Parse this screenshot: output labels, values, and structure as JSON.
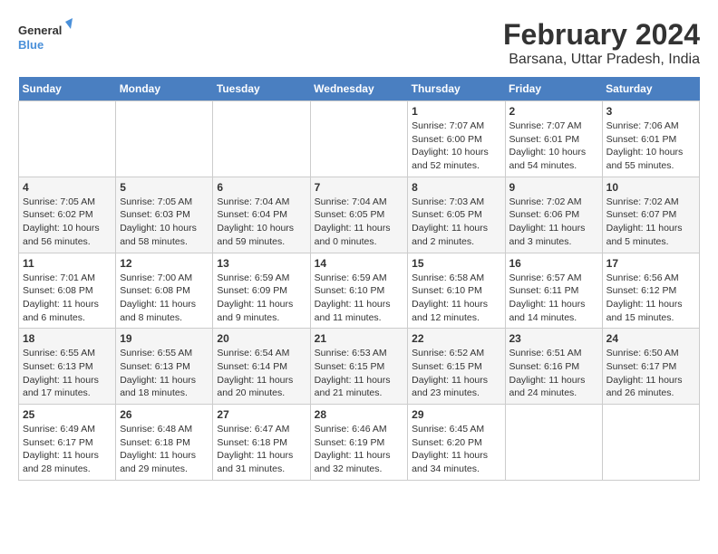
{
  "logo": {
    "line1": "General",
    "line2": "Blue"
  },
  "title": "February 2024",
  "subtitle": "Barsana, Uttar Pradesh, India",
  "days_header": [
    "Sunday",
    "Monday",
    "Tuesday",
    "Wednesday",
    "Thursday",
    "Friday",
    "Saturday"
  ],
  "weeks": [
    [
      {
        "num": "",
        "info": ""
      },
      {
        "num": "",
        "info": ""
      },
      {
        "num": "",
        "info": ""
      },
      {
        "num": "",
        "info": ""
      },
      {
        "num": "1",
        "info": "Sunrise: 7:07 AM\nSunset: 6:00 PM\nDaylight: 10 hours\nand 52 minutes."
      },
      {
        "num": "2",
        "info": "Sunrise: 7:07 AM\nSunset: 6:01 PM\nDaylight: 10 hours\nand 54 minutes."
      },
      {
        "num": "3",
        "info": "Sunrise: 7:06 AM\nSunset: 6:01 PM\nDaylight: 10 hours\nand 55 minutes."
      }
    ],
    [
      {
        "num": "4",
        "info": "Sunrise: 7:05 AM\nSunset: 6:02 PM\nDaylight: 10 hours\nand 56 minutes."
      },
      {
        "num": "5",
        "info": "Sunrise: 7:05 AM\nSunset: 6:03 PM\nDaylight: 10 hours\nand 58 minutes."
      },
      {
        "num": "6",
        "info": "Sunrise: 7:04 AM\nSunset: 6:04 PM\nDaylight: 10 hours\nand 59 minutes."
      },
      {
        "num": "7",
        "info": "Sunrise: 7:04 AM\nSunset: 6:05 PM\nDaylight: 11 hours\nand 0 minutes."
      },
      {
        "num": "8",
        "info": "Sunrise: 7:03 AM\nSunset: 6:05 PM\nDaylight: 11 hours\nand 2 minutes."
      },
      {
        "num": "9",
        "info": "Sunrise: 7:02 AM\nSunset: 6:06 PM\nDaylight: 11 hours\nand 3 minutes."
      },
      {
        "num": "10",
        "info": "Sunrise: 7:02 AM\nSunset: 6:07 PM\nDaylight: 11 hours\nand 5 minutes."
      }
    ],
    [
      {
        "num": "11",
        "info": "Sunrise: 7:01 AM\nSunset: 6:08 PM\nDaylight: 11 hours\nand 6 minutes."
      },
      {
        "num": "12",
        "info": "Sunrise: 7:00 AM\nSunset: 6:08 PM\nDaylight: 11 hours\nand 8 minutes."
      },
      {
        "num": "13",
        "info": "Sunrise: 6:59 AM\nSunset: 6:09 PM\nDaylight: 11 hours\nand 9 minutes."
      },
      {
        "num": "14",
        "info": "Sunrise: 6:59 AM\nSunset: 6:10 PM\nDaylight: 11 hours\nand 11 minutes."
      },
      {
        "num": "15",
        "info": "Sunrise: 6:58 AM\nSunset: 6:10 PM\nDaylight: 11 hours\nand 12 minutes."
      },
      {
        "num": "16",
        "info": "Sunrise: 6:57 AM\nSunset: 6:11 PM\nDaylight: 11 hours\nand 14 minutes."
      },
      {
        "num": "17",
        "info": "Sunrise: 6:56 AM\nSunset: 6:12 PM\nDaylight: 11 hours\nand 15 minutes."
      }
    ],
    [
      {
        "num": "18",
        "info": "Sunrise: 6:55 AM\nSunset: 6:13 PM\nDaylight: 11 hours\nand 17 minutes."
      },
      {
        "num": "19",
        "info": "Sunrise: 6:55 AM\nSunset: 6:13 PM\nDaylight: 11 hours\nand 18 minutes."
      },
      {
        "num": "20",
        "info": "Sunrise: 6:54 AM\nSunset: 6:14 PM\nDaylight: 11 hours\nand 20 minutes."
      },
      {
        "num": "21",
        "info": "Sunrise: 6:53 AM\nSunset: 6:15 PM\nDaylight: 11 hours\nand 21 minutes."
      },
      {
        "num": "22",
        "info": "Sunrise: 6:52 AM\nSunset: 6:15 PM\nDaylight: 11 hours\nand 23 minutes."
      },
      {
        "num": "23",
        "info": "Sunrise: 6:51 AM\nSunset: 6:16 PM\nDaylight: 11 hours\nand 24 minutes."
      },
      {
        "num": "24",
        "info": "Sunrise: 6:50 AM\nSunset: 6:17 PM\nDaylight: 11 hours\nand 26 minutes."
      }
    ],
    [
      {
        "num": "25",
        "info": "Sunrise: 6:49 AM\nSunset: 6:17 PM\nDaylight: 11 hours\nand 28 minutes."
      },
      {
        "num": "26",
        "info": "Sunrise: 6:48 AM\nSunset: 6:18 PM\nDaylight: 11 hours\nand 29 minutes."
      },
      {
        "num": "27",
        "info": "Sunrise: 6:47 AM\nSunset: 6:18 PM\nDaylight: 11 hours\nand 31 minutes."
      },
      {
        "num": "28",
        "info": "Sunrise: 6:46 AM\nSunset: 6:19 PM\nDaylight: 11 hours\nand 32 minutes."
      },
      {
        "num": "29",
        "info": "Sunrise: 6:45 AM\nSunset: 6:20 PM\nDaylight: 11 hours\nand 34 minutes."
      },
      {
        "num": "",
        "info": ""
      },
      {
        "num": "",
        "info": ""
      }
    ]
  ]
}
